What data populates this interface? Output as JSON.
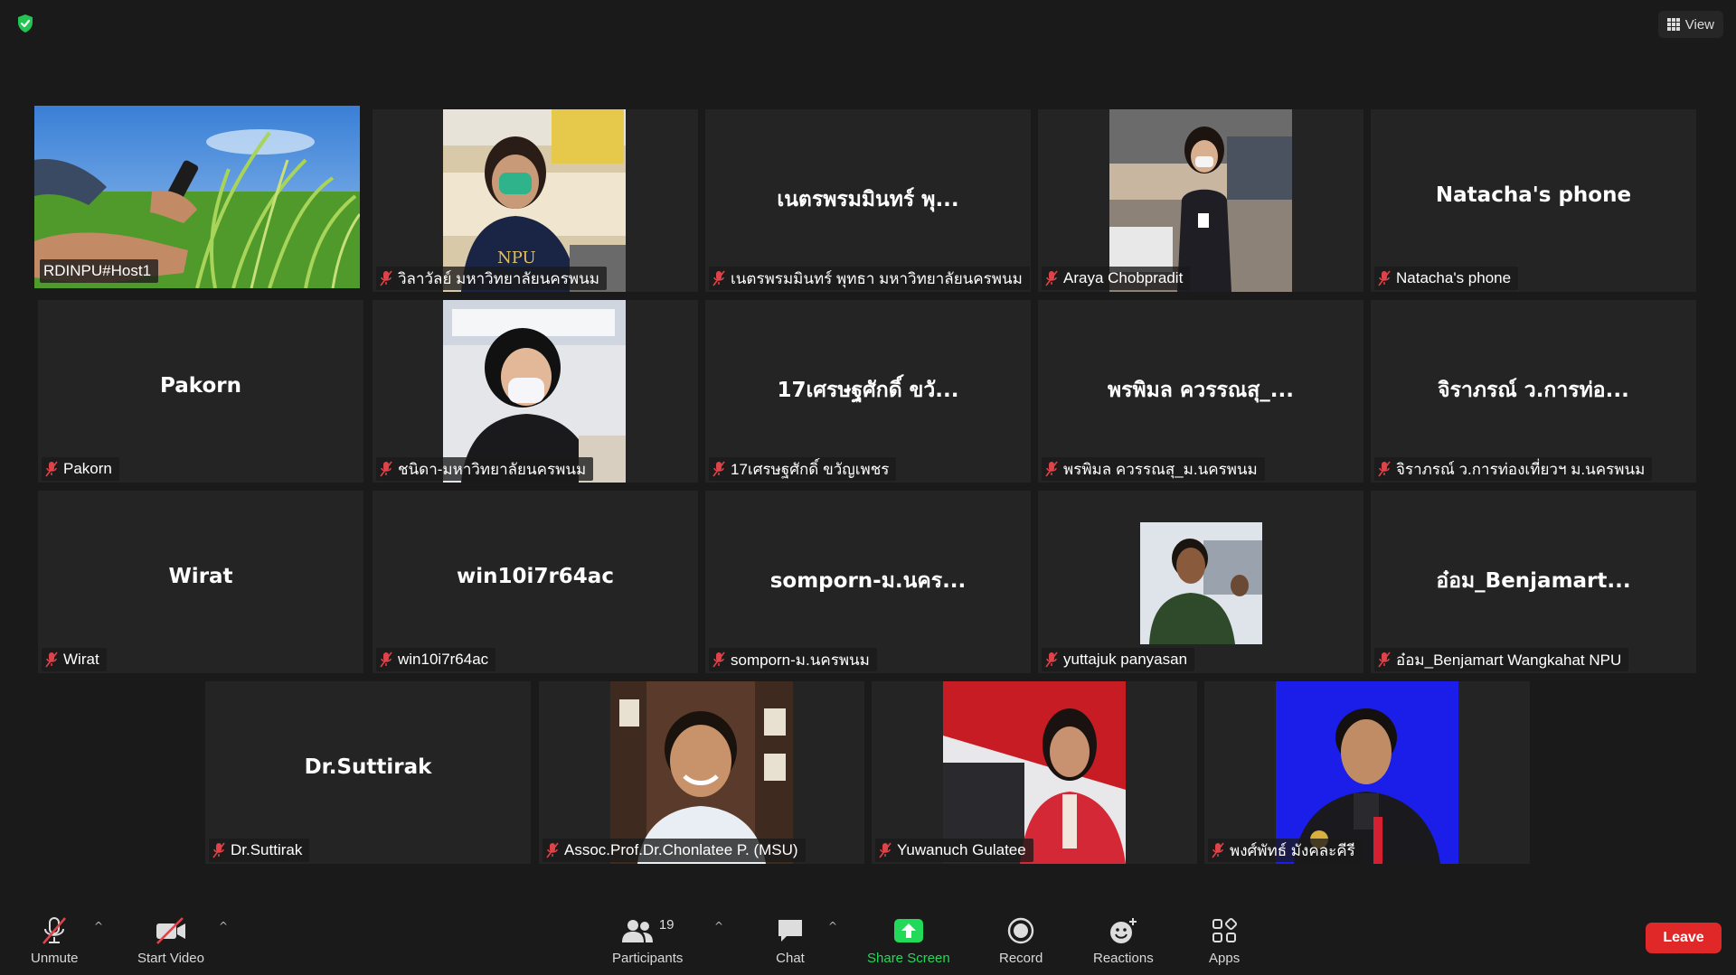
{
  "top": {
    "view_label": "View"
  },
  "tiles": [
    {
      "display": "",
      "tag": "RDINPU#Host1"
    },
    {
      "display": "",
      "tag": "วิลาวัลย์ มหาวิทยาลัยนครพนม"
    },
    {
      "display": "เนตรพรมมินทร์ พุ...",
      "tag": "เนตรพรมมินทร์ พุทธา มหาวิทยาลัยนครพนม"
    },
    {
      "display": "",
      "tag": "Araya Chobpradit"
    },
    {
      "display": "Natacha's phone",
      "tag": "Natacha's phone"
    },
    {
      "display": "Pakorn",
      "tag": "Pakorn"
    },
    {
      "display": "",
      "tag": "ชนิดา-มหาวิทยาลัยนครพนม"
    },
    {
      "display": "17เศรษฐศักดิ์ ขวั...",
      "tag": "17เศรษฐศักดิ์ ขวัญเพชร"
    },
    {
      "display": "พรพิมล ควรรณสุ_...",
      "tag": "พรพิมล ควรรณสุ_ม.นครพนม"
    },
    {
      "display": "จิราภรณ์ ว.การท่อ...",
      "tag": "จิราภรณ์ ว.การท่องเที่ยวฯ ม.นครพนม"
    },
    {
      "display": "Wirat",
      "tag": "Wirat"
    },
    {
      "display": "win10i7r64ac",
      "tag": "win10i7r64ac"
    },
    {
      "display": "somporn-ม.นคร...",
      "tag": "somporn-ม.นครพนม"
    },
    {
      "display": "",
      "tag": "yuttajuk panyasan"
    },
    {
      "display": "อ๋อม_Benjamart...",
      "tag": "อ๋อม_Benjamart Wangkahat NPU"
    },
    {
      "display": "Dr.Suttirak",
      "tag": "Dr.Suttirak"
    },
    {
      "display": "",
      "tag": "Assoc.Prof.Dr.Chonlatee P. (MSU)"
    },
    {
      "display": "",
      "tag": "Yuwanuch Gulatee"
    },
    {
      "display": "",
      "tag": "พงศ์พัทธ์ มังคละคีรี"
    }
  ],
  "toolbar": {
    "unmute": "Unmute",
    "start_video": "Start Video",
    "participants": "Participants",
    "participants_count": "19",
    "chat": "Chat",
    "share_screen": "Share Screen",
    "record": "Record",
    "reactions": "Reactions",
    "apps": "Apps",
    "leave": "Leave"
  },
  "colors": {
    "background": "#1a1a1a",
    "tile": "#242424",
    "active_speaker": "#e8ec5a",
    "share_screen": "#23d959",
    "leave": "#e02828",
    "muted_mic": "#e0424a"
  }
}
